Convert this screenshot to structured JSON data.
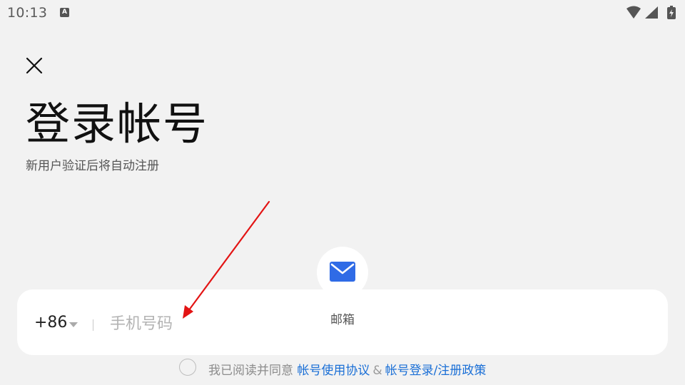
{
  "status_bar": {
    "time": "10:13",
    "app_badge": "A",
    "icons": [
      "wifi-icon",
      "signal-icon",
      "battery-charging-icon"
    ]
  },
  "header": {
    "close_icon": "close-icon",
    "title": "登录帐号",
    "subtitle": "新用户验证后将自动注册"
  },
  "login_form": {
    "country_code": "+86",
    "separator": "|",
    "phone_placeholder": "手机号码",
    "phone_value": ""
  },
  "alt_login": {
    "email_icon": "mail-icon",
    "email_label": "邮箱",
    "email_icon_color": "#2f6be6"
  },
  "agreement": {
    "checked": false,
    "prefix": "我已阅读并同意",
    "link_terms": "帐号使用协议",
    "ampersand": "&",
    "link_privacy": "帐号登录/注册政策",
    "link_color": "#1a6fd6"
  },
  "annotation": {
    "type": "red-arrow",
    "color": "#e31414"
  },
  "colors": {
    "background": "#f2f2f2",
    "card": "#ffffff",
    "title_text": "#111111",
    "placeholder": "#b3b3b3"
  }
}
